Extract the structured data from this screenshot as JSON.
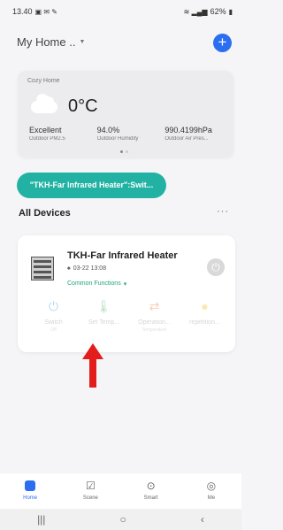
{
  "status_bar": {
    "time": "13.40",
    "battery": "62%"
  },
  "header": {
    "home_name": "My Home .."
  },
  "weather": {
    "home_label": "Cozy Home",
    "temperature": "0°C",
    "stats": [
      {
        "value": "Excellent",
        "label": "Outdoor PM2.5"
      },
      {
        "value": "94.0%",
        "label": "Outdoor Humidity"
      },
      {
        "value": "990.4199hPa",
        "label": "Outdoor Air Pres..."
      }
    ]
  },
  "scene_pill": {
    "label": "\"TKH-Far Infrared Heater\":Swit..."
  },
  "section": {
    "title": "All Devices"
  },
  "device": {
    "name": "TKH-Far Infrared Heater",
    "date": "03-22 13:08",
    "common_functions": "Common Functions",
    "functions": [
      {
        "label": "Switch",
        "value": "Off",
        "icon": "power-icon"
      },
      {
        "label": "Set Temp...",
        "value": "",
        "icon": "thermometer-icon"
      },
      {
        "label": "Operation...",
        "value": "Temperature",
        "icon": "swap-icon"
      },
      {
        "label": "repetition...",
        "value": "",
        "icon": "sun-icon"
      }
    ]
  },
  "tabs": [
    {
      "label": "Home",
      "icon": "home-icon"
    },
    {
      "label": "Scene",
      "icon": "scene-icon"
    },
    {
      "label": "Smart",
      "icon": "smart-icon"
    },
    {
      "label": "Me",
      "icon": "me-icon"
    }
  ],
  "colors": {
    "accent": "#2b6ff0",
    "teal": "#22b2a4",
    "arrow": "#e31c1c",
    "green": "#22a67a"
  }
}
